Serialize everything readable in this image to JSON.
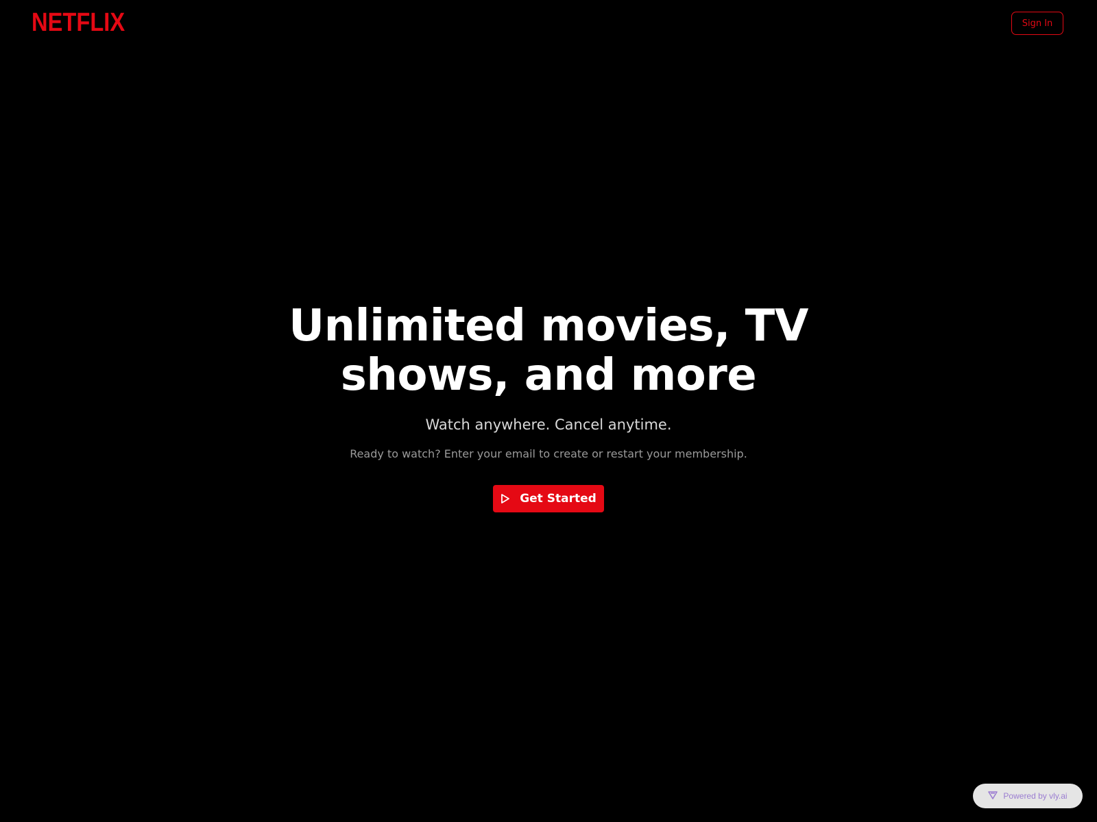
{
  "header": {
    "logo_text": "NETFLIX",
    "signin_label": "Sign In"
  },
  "hero": {
    "headline_line1": "Unlimited movies, TV",
    "headline_line2": "shows, and more",
    "subheadline": "Watch anywhere. Cancel anytime.",
    "cta_text": "Ready to watch? Enter your email to create or restart your membership.",
    "cta_button_label": "Get Started",
    "cta_button_icon": "play-icon"
  },
  "badge": {
    "label": "Powered by vly.ai",
    "icon": "vly-logo-icon"
  },
  "colors": {
    "background": "#000000",
    "brand": "#E50914",
    "headline": "#FFFFFF",
    "subheadline": "#D9D9D9",
    "muted": "#9A9A9A",
    "badge_bg": "#E5E5E5",
    "badge_text": "#9B7DD1"
  }
}
